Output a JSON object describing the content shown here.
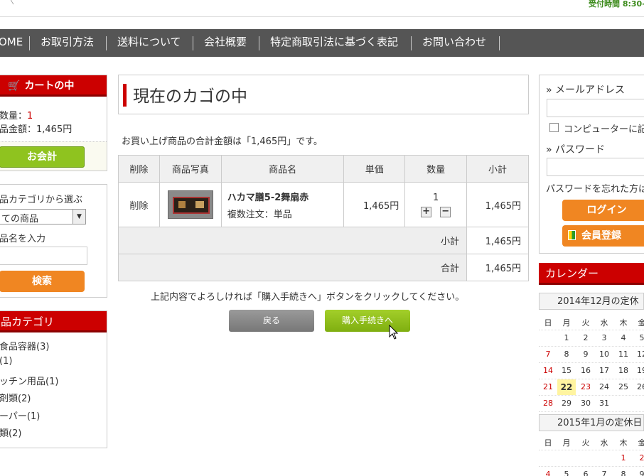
{
  "header": {
    "hours": "受付時間 8:30-"
  },
  "nav": [
    "OME",
    "お取引方法",
    "送料について",
    "会社概要",
    "特定商取引法に基づく表記",
    "お問い合わせ"
  ],
  "cart_box": {
    "title": "カートの中",
    "qty_label": "数量：",
    "qty_value": "1",
    "total_label": "品金額：1,465円",
    "checkout": "お会計"
  },
  "search_box": {
    "category_label": "品カテゴリから選ぶ",
    "category_selected": "ての商品",
    "name_label": "品名を入力",
    "search_button": "検索"
  },
  "category_box": {
    "title": "品カテゴリ",
    "items": [
      "食品容器(3)",
      "(1)",
      "ッチン用品(1)",
      "剤類(2)",
      "ーパー(1)",
      "類(2)"
    ]
  },
  "main": {
    "title": "現在のカゴの中",
    "total_message": "お買い上げ商品の合計金額は「1,465円」です。",
    "table": {
      "headers": [
        "削除",
        "商品写真",
        "商品名",
        "単価",
        "数量",
        "小計"
      ],
      "row": {
        "delete": "削除",
        "name": "ハカマ膳5-2舞扇赤",
        "option": "複数注文：単品",
        "unit_price": "1,465円",
        "qty": "1",
        "subtotal": "1,465円"
      },
      "subtotal_label": "小計",
      "subtotal_value": "1,465円",
      "total_label": "合計",
      "total_value": "1,465円"
    },
    "confirm_message": "上記内容でよろしければ「購入手続きへ」ボタンをクリックしてください。",
    "back_button": "戻る",
    "purchase_button": "購入手続きへ"
  },
  "login": {
    "email_label": "» メールアドレス",
    "remember_label": "コンピューターに記憶",
    "password_label": "» パスワード",
    "forgot": "パスワードを忘れた方はこ",
    "login_button": "ログイン",
    "register_button": "会員登録"
  },
  "calendar": {
    "title": "カレンダー",
    "dec_title": "2014年12月の定休",
    "weekdays": [
      "日",
      "月",
      "火",
      "水",
      "木",
      "金"
    ],
    "dec_rows": [
      [
        "",
        "1",
        "2",
        "3",
        "4",
        "5"
      ],
      [
        "7",
        "8",
        "9",
        "10",
        "11",
        "12"
      ],
      [
        "14",
        "15",
        "16",
        "17",
        "18",
        "19"
      ],
      [
        "21",
        "22",
        "23",
        "24",
        "25",
        "26"
      ],
      [
        "28",
        "29",
        "30",
        "31",
        "",
        ""
      ]
    ],
    "jan_title": "2015年1月の定休日",
    "jan_rows": [
      [
        "",
        "",
        "",
        "",
        "1",
        "2"
      ],
      [
        "4",
        "5",
        "6",
        "7",
        "8",
        "9"
      ]
    ]
  }
}
